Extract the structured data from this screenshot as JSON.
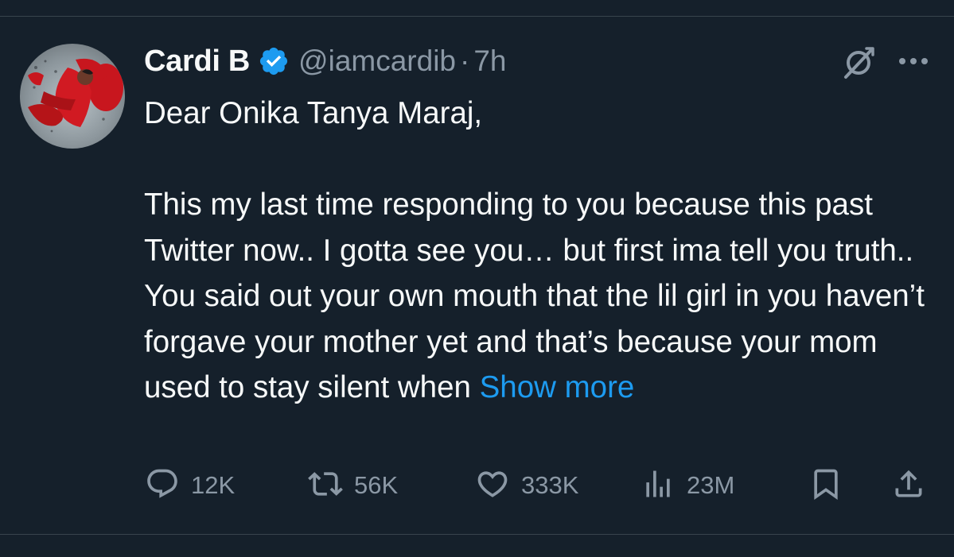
{
  "tweet": {
    "author": {
      "display_name": "Cardi B",
      "handle": "@iamcardib",
      "verified": true,
      "avatar": "avatar-photo"
    },
    "separator": "·",
    "time": "7h",
    "text": {
      "greeting": "Dear Onika Tanya Maraj,",
      "body": "This my last time responding to you because this past Twitter now.. I gotta see you… but first ima tell you truth.. You said out your own mouth that the lil girl in you haven’t forgave your mother yet and that’s because your mom used to stay silent when",
      "show_more": "Show more"
    },
    "actions": {
      "replies": "12K",
      "retweets": "56K",
      "likes": "333K",
      "views": "23M"
    }
  },
  "icons": {
    "verified": "verified-badge-icon",
    "grok": "grok-icon",
    "more": "more-icon",
    "reply": "reply-icon",
    "retweet": "retweet-icon",
    "like": "heart-icon",
    "views": "views-icon",
    "bookmark": "bookmark-icon",
    "share": "share-icon"
  },
  "colors": {
    "background": "#15202b",
    "text": "#f7f9f9",
    "secondary": "#8b98a5",
    "accent": "#1d9bf0",
    "divider": "#38444d"
  }
}
